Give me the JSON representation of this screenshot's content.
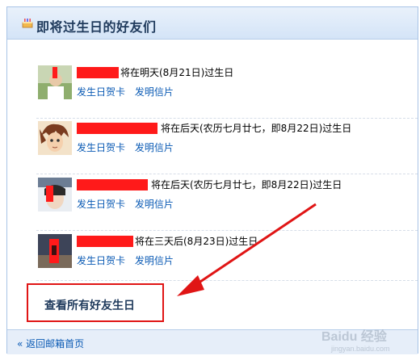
{
  "header": {
    "title": "即将过生日的好友们",
    "icon": "cake-icon"
  },
  "friends": [
    {
      "info": "将在明天(8月21日)过生日",
      "card": "发生日贺卡",
      "postcard": "发明信片"
    },
    {
      "info": "将在后天(农历七月廿七，即8月22日)过生日",
      "card": "发生日贺卡",
      "postcard": "发明信片"
    },
    {
      "info": "将在后天(农历七月廿七，即8月22日)过生日",
      "card": "发生日贺卡",
      "postcard": "发明信片"
    },
    {
      "info": "将在三天后(8月23日)过生日",
      "card": "发生日贺卡",
      "postcard": "发明信片"
    }
  ],
  "see_all": "查看所有好友生日",
  "footer": {
    "back": "« 返回邮箱首页"
  },
  "watermark": {
    "brand": "Baidu 经验",
    "url": "jingyan.baidu.com"
  },
  "colors": {
    "accent": "#0a5ab4",
    "highlight": "#e01515",
    "header_bg": "#d4e4f7"
  }
}
